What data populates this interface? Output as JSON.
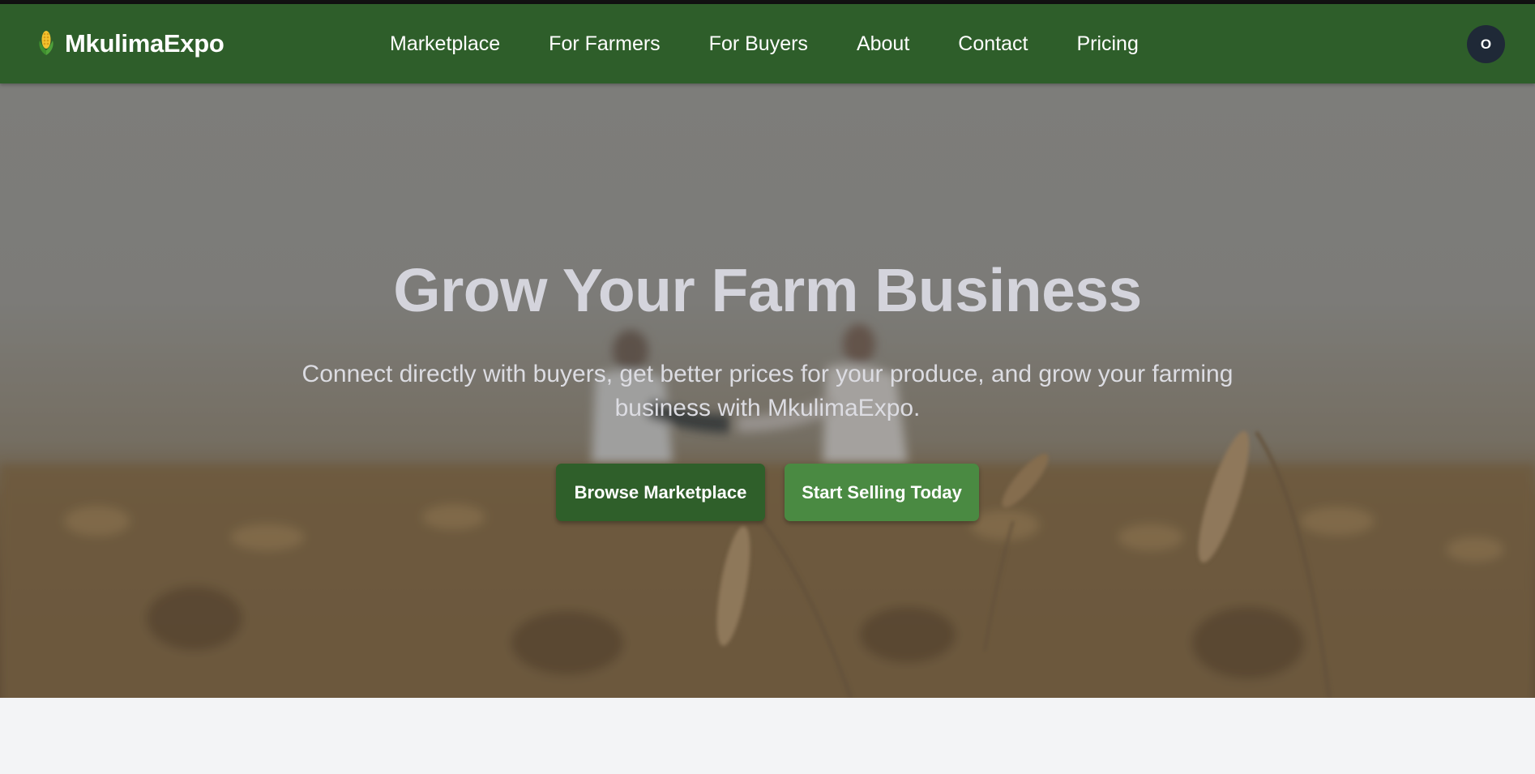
{
  "brand": {
    "name": "MkulimaExpo",
    "icon": "corn-icon"
  },
  "nav": {
    "items": [
      {
        "label": "Marketplace"
      },
      {
        "label": "For Farmers"
      },
      {
        "label": "For Buyers"
      },
      {
        "label": "About"
      },
      {
        "label": "Contact"
      },
      {
        "label": "Pricing"
      }
    ]
  },
  "user": {
    "avatar_initial": "O"
  },
  "hero": {
    "title": "Grow Your Farm Business",
    "subtitle": "Connect directly with buyers, get better prices for your produce, and grow your farming business with MkulimaExpo.",
    "primary_button": "Browse Marketplace",
    "secondary_button": "Start Selling Today",
    "background_image": "wheat-field-handshake"
  },
  "colors": {
    "nav_bg": "#2e5e2a",
    "primary_button": "#2f5f2a",
    "secondary_button": "#4a8a42",
    "avatar_bg": "#1f2937",
    "page_bg": "#f3f4f6"
  }
}
